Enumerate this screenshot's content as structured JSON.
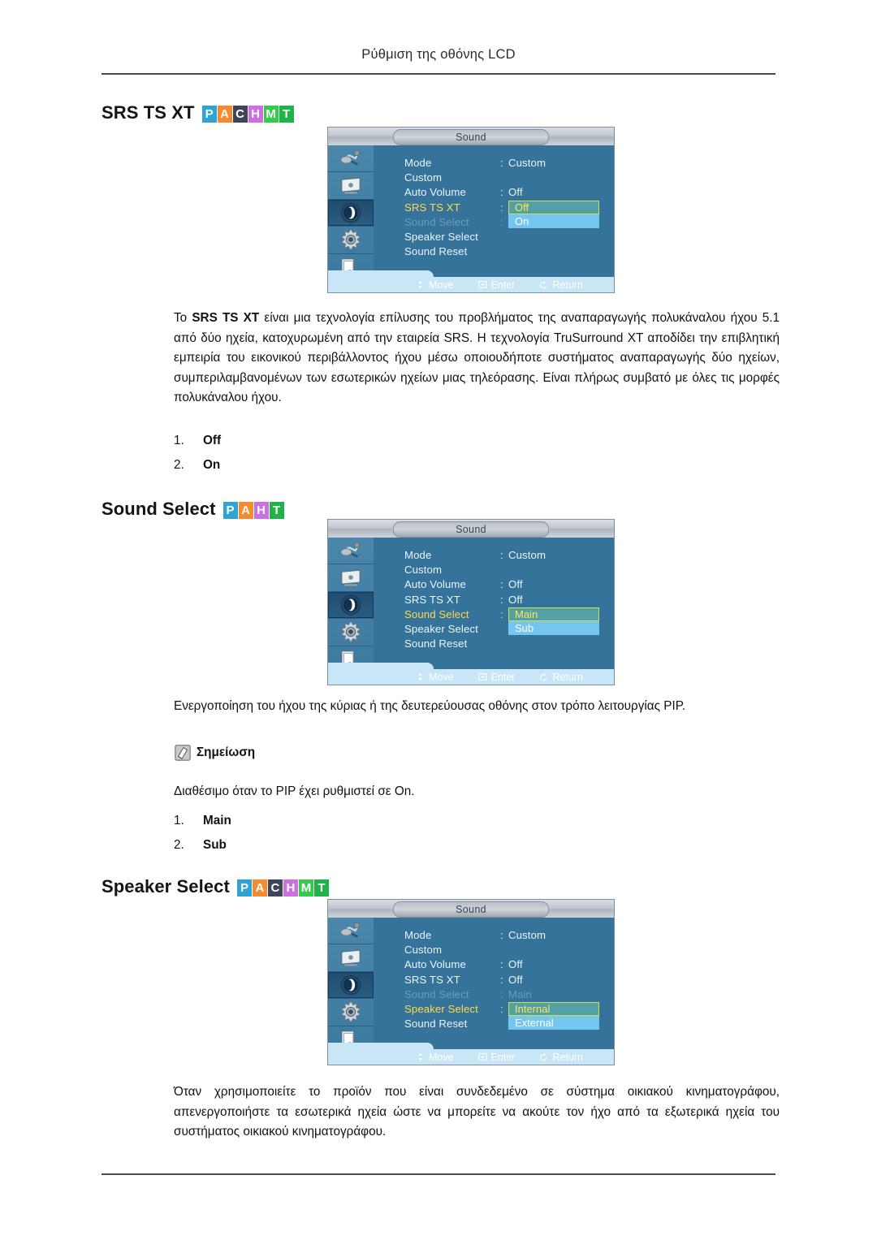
{
  "header": {
    "title": "Ρύθμιση της οθόνης LCD"
  },
  "badge_colors": {
    "P": "#2ea3d4",
    "A": "#f58a2e",
    "C": "#3f4557",
    "H": "#cc6fe0",
    "M": "#36cc4a",
    "T": "#21b34a"
  },
  "osd_common": {
    "title": "Sound",
    "footer": [
      {
        "icon": "move-icon",
        "label": "Move"
      },
      {
        "icon": "enter-icon",
        "label": "Enter"
      },
      {
        "icon": "return-icon",
        "label": "Return"
      }
    ],
    "sidebar_icons": [
      "input-source-icon",
      "picture-icon",
      "sound-icon",
      "setup-gear-icon",
      "multi-control-icon"
    ]
  },
  "sections": [
    {
      "id": "srs-ts-xt",
      "heading": "SRS TS XT",
      "badges": [
        "P",
        "A",
        "C",
        "H",
        "M",
        "T"
      ],
      "osd": {
        "rows": [
          {
            "label": "Mode",
            "colon": ":",
            "value": "Custom",
            "state": "normal"
          },
          {
            "label": "Custom",
            "colon": "",
            "value": "",
            "state": "normal"
          },
          {
            "label": "Auto Volume",
            "colon": ":",
            "value": "Off",
            "state": "normal"
          },
          {
            "label": "SRS TS XT",
            "colon": ":",
            "value": "",
            "state": "selected"
          },
          {
            "label": "Sound Select",
            "colon": ":",
            "value": "",
            "state": "dim"
          },
          {
            "label": "Speaker Select",
            "colon": "",
            "value": "",
            "state": "normal"
          },
          {
            "label": "Sound Reset",
            "colon": "",
            "value": "",
            "state": "normal"
          }
        ],
        "popup": {
          "current": "Off",
          "alternate": "On",
          "top_row": 3
        }
      },
      "paragraph": "Το SRS TS XT είναι μια τεχνολογία επίλυσης του προβλήματος της αναπαραγωγής πολυκάναλου ήχου 5.1 από δύο ηχεία, κατοχυρωμένη από την εταιρεία SRS. Η τεχνολογία TruSurround XT αποδίδει την επιβλητική εμπειρία του εικονικού περιβάλλοντος ήχου μέσω οποιουδήποτε συστήματος αναπαραγωγής δύο ηχείων, συμπεριλαμβανομένων των εσωτερικών ηχείων μιας τηλεόρασης. Είναι πλήρως συμβατό με όλες τις μορφές πολυκάναλου ήχου.",
      "paragraph_bold": "SRS TS XT",
      "list": [
        {
          "num": "1.",
          "value": "Off"
        },
        {
          "num": "2.",
          "value": "On"
        }
      ]
    },
    {
      "id": "sound-select",
      "heading": "Sound Select",
      "badges": [
        "P",
        "A",
        "H",
        "T"
      ],
      "osd": {
        "rows": [
          {
            "label": "Mode",
            "colon": ":",
            "value": "Custom",
            "state": "normal"
          },
          {
            "label": "Custom",
            "colon": "",
            "value": "",
            "state": "normal"
          },
          {
            "label": "Auto Volume",
            "colon": ":",
            "value": "Off",
            "state": "normal"
          },
          {
            "label": "SRS TS XT",
            "colon": ":",
            "value": "Off",
            "state": "normal"
          },
          {
            "label": "Sound Select",
            "colon": ":",
            "value": "",
            "state": "selected"
          },
          {
            "label": "Speaker Select",
            "colon": "",
            "value": "",
            "state": "normal"
          },
          {
            "label": "Sound Reset",
            "colon": "",
            "value": "",
            "state": "normal"
          }
        ],
        "popup": {
          "current": "Main",
          "alternate": "Sub",
          "top_row": 4
        }
      },
      "paragraph": "Ενεργοποίηση του ήχου της κύριας ή της δευτερεύουσας οθόνης στον τρόπο λειτουργίας PIP.",
      "note_label": "Σημείωση",
      "note_text": "Διαθέσιμο όταν το PIP έχει ρυθμιστεί σε On.",
      "list": [
        {
          "num": "1.",
          "value": "Main"
        },
        {
          "num": "2.",
          "value": "Sub"
        }
      ]
    },
    {
      "id": "speaker-select",
      "heading": "Speaker Select",
      "badges": [
        "P",
        "A",
        "C",
        "H",
        "M",
        "T"
      ],
      "osd": {
        "rows": [
          {
            "label": "Mode",
            "colon": ":",
            "value": "Custom",
            "state": "normal"
          },
          {
            "label": "Custom",
            "colon": "",
            "value": "",
            "state": "normal"
          },
          {
            "label": "Auto Volume",
            "colon": ":",
            "value": "Off",
            "state": "normal"
          },
          {
            "label": "SRS TS XT",
            "colon": ":",
            "value": "Off",
            "state": "normal"
          },
          {
            "label": "Sound Select",
            "colon": ":",
            "value": "Main",
            "state": "dim"
          },
          {
            "label": "Speaker Select",
            "colon": ":",
            "value": "",
            "state": "selected"
          },
          {
            "label": "Sound Reset",
            "colon": "",
            "value": "",
            "state": "normal"
          }
        ],
        "popup": {
          "current": "Internal",
          "alternate": "External",
          "top_row": 5
        }
      },
      "paragraph": "Όταν χρησιμοποιείτε το προϊόν που είναι συνδεδεμένο σε σύστημα οικιακού κινηματογράφου, απενεργοποιήστε τα εσωτερικά ηχεία ώστε να μπορείτε να ακούτε τον ήχο από τα εξωτερικά ηχεία του συστήματος οικιακού κινηματογράφου."
    }
  ]
}
